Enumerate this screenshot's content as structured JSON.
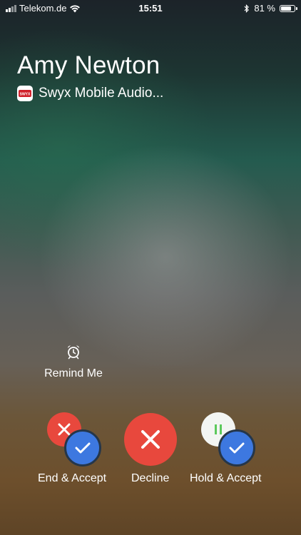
{
  "status_bar": {
    "carrier": "Telekom.de",
    "time": "15:51",
    "battery_percent": "81 %",
    "battery_level": 0.81,
    "icons": [
      "signal-icon",
      "wifi-icon",
      "bluetooth-icon",
      "battery-icon"
    ]
  },
  "caller": {
    "name": "Amy Newton",
    "app_label": "Swyx Mobile Audio...",
    "app_icon_text": "SWYX",
    "app_icon_color": "#d0202a"
  },
  "remind": {
    "label": "Remind Me",
    "icon": "alarm-clock-icon"
  },
  "actions": {
    "end_accept": {
      "label": "End & Accept"
    },
    "decline": {
      "label": "Decline"
    },
    "hold_accept": {
      "label": "Hold & Accept"
    }
  },
  "colors": {
    "decline_red": "#e8483d",
    "accept_blue": "#3d78e0",
    "hold_white": "#f3f5f3",
    "pause_green": "#5cc95c"
  }
}
